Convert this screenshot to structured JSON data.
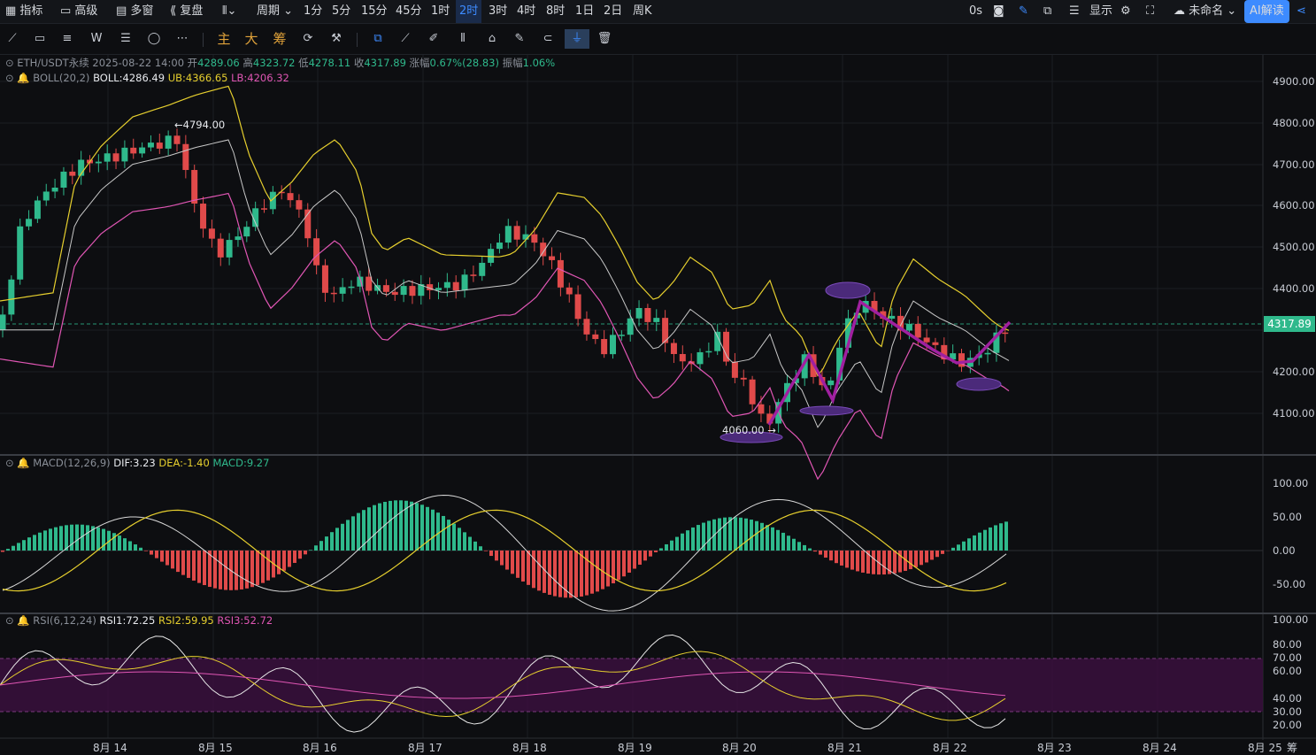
{
  "topbar": {
    "indicators": "指标",
    "advanced": "高级",
    "multi_window": "多窗",
    "replay": "复盘",
    "period": "周期",
    "intervals": [
      "1分",
      "5分",
      "15分",
      "45分",
      "1时",
      "2时",
      "3时",
      "4时",
      "8时",
      "1日",
      "2日",
      "周K"
    ],
    "active_interval": "2时",
    "countdown": "0s",
    "display": "显示",
    "layout_name": "未命名",
    "ai_button": "AI解读"
  },
  "toolbar": {
    "main": "主",
    "big": "大",
    "chips": "筹"
  },
  "main_panel": {
    "symbol": "ETH/USDT永续",
    "datetime": "2025-08-22 14:00",
    "open_label": "开",
    "open": "4289.06",
    "high_label": "高",
    "high": "4323.72",
    "low_label": "低",
    "low": "4278.11",
    "close_label": "收",
    "close": "4317.89",
    "change_label": "涨幅",
    "change": "0.67%(28.83)",
    "amp_label": "振幅",
    "amp": "1.06%",
    "boll_name": "BOLL(20,2)",
    "boll": "BOLL:4286.49",
    "ub": "UB:4366.65",
    "lb": "LB:4206.32",
    "high_marker": "4794.00",
    "low_marker": "4060.00",
    "current_price": "4317.89",
    "y_ticks": [
      "4900.00",
      "4800.00",
      "4700.00",
      "4600.00",
      "4500.00",
      "4400.00",
      "4300.00",
      "4200.00",
      "4100.00"
    ]
  },
  "macd_panel": {
    "name": "MACD(12,26,9)",
    "dif": "DIF:3.23",
    "dea": "DEA:-1.40",
    "macd": "MACD:9.27",
    "y_ticks": [
      "100.00",
      "50.00",
      "0.00",
      "-50.00"
    ]
  },
  "rsi_panel": {
    "name": "RSI(6,12,24)",
    "rsi1": "RSI1:72.25",
    "rsi2": "RSI2:59.95",
    "rsi3": "RSI3:52.72",
    "y_ticks": [
      "100.00",
      "80.00",
      "70.00",
      "60.00",
      "40.00",
      "30.00",
      "20.00"
    ]
  },
  "x_axis": [
    "8月 14",
    "8月 15",
    "8月 16",
    "8月 17",
    "8月 18",
    "8月 19",
    "8月 20",
    "8月 21",
    "8月 22",
    "8月 23",
    "8月 24",
    "8月 25"
  ],
  "x_axis_suffix": "筹",
  "colors": {
    "up": "#2fb98c",
    "down": "#e04a4a",
    "boll_mid": "#c8c8c8",
    "boll_ub": "#e6cf2e",
    "boll_lb": "#e056b4",
    "pattern": "#a020a0",
    "accent": "#3d8bff"
  }
}
